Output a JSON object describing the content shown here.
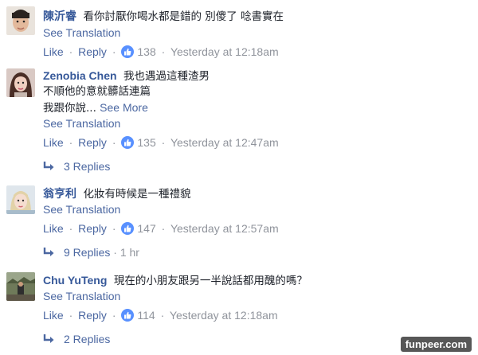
{
  "comments": [
    {
      "author": "陳沂睿",
      "lines": [
        "看你討厭你喝水都是錯的 別傻了 唸書實在"
      ],
      "see_translation": "See Translation",
      "like_label": "Like",
      "reply_label": "Reply",
      "like_count": "138",
      "timestamp": "Yesterday at 12:18am"
    },
    {
      "author": "Zenobia Chen",
      "lines": [
        "我也遇過這種渣男",
        "不順他的意就髒話連篇",
        "我跟你說..."
      ],
      "see_more": "See More",
      "see_translation": "See Translation",
      "like_label": "Like",
      "reply_label": "Reply",
      "like_count": "135",
      "timestamp": "Yesterday at 12:47am",
      "replies": "3 Replies"
    },
    {
      "author": "翁亨利",
      "lines": [
        "化妝有時候是一種禮貌"
      ],
      "see_translation": "See Translation",
      "like_label": "Like",
      "reply_label": "Reply",
      "like_count": "147",
      "timestamp": "Yesterday at 12:57am",
      "replies": "9 Replies",
      "replies_time": "1 hr"
    },
    {
      "author": "Chu YuTeng",
      "lines": [
        "現在的小朋友跟另一半說話都用醜的嗎？"
      ],
      "see_translation": "See Translation",
      "like_label": "Like",
      "reply_label": "Reply",
      "like_count": "114",
      "timestamp": "Yesterday at 12:18am",
      "replies": "2 Replies"
    }
  ],
  "watermark": "funpeer.com",
  "colors": {
    "author": "#365899",
    "link": "#4b67a1",
    "meta": "#90949c",
    "like_bubble": "#5890ff"
  },
  "icons": {
    "like": "thumbs-up-icon",
    "reply_arrow": "reply-arrow-icon"
  }
}
